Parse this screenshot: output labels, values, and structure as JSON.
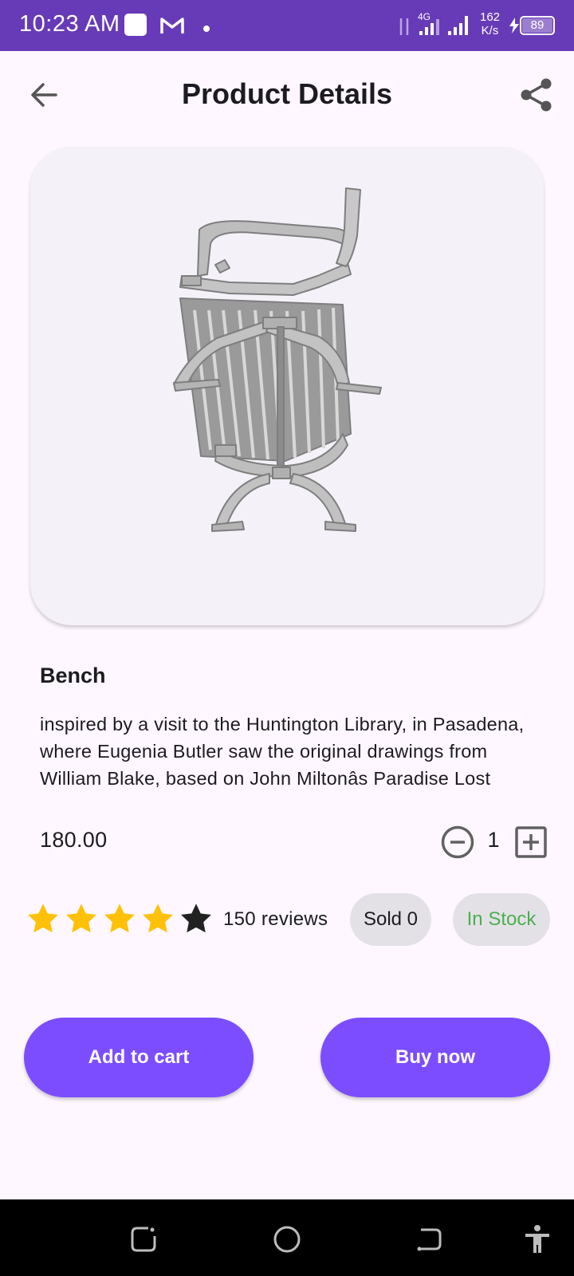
{
  "status_bar": {
    "time": "10:23 AM",
    "network": "4G",
    "speed_value": "162",
    "speed_unit": "K/s",
    "battery": "89",
    "icons": [
      "notification-square-icon",
      "gmail-icon",
      "dot-icon",
      "data-arrows-icon",
      "signal-icon",
      "signal-icon",
      "charging-icon",
      "battery-icon"
    ]
  },
  "app_bar": {
    "title": "Product Details",
    "back_icon": "arrow-back-icon",
    "share_icon": "share-icon"
  },
  "product": {
    "image": "bench-3d-model",
    "name": "Bench",
    "description": "inspired by a visit to the Huntington Library, in Pasadena, where Eugenia Butler saw the original drawings from William Blake, based on John Miltonâs Paradise Lost",
    "price": "180.00",
    "quantity": "1",
    "rating": 4,
    "rating_max": 5,
    "reviews": "150 reviews",
    "sold": "Sold 0",
    "stock": "In Stock"
  },
  "actions": {
    "add_to_cart": "Add to cart",
    "buy_now": "Buy now"
  },
  "colors": {
    "status_bar": "#673AB7",
    "background": "#FEF7FF",
    "button": "#7C4DFF",
    "star_filled": "#FFC107",
    "star_empty": "#212121",
    "in_stock": "#4CAF50",
    "chip": "#E3E1E6"
  },
  "nav_bar": {
    "icons": [
      "recent-apps-icon",
      "home-icon",
      "back-icon",
      "accessibility-icon"
    ]
  }
}
